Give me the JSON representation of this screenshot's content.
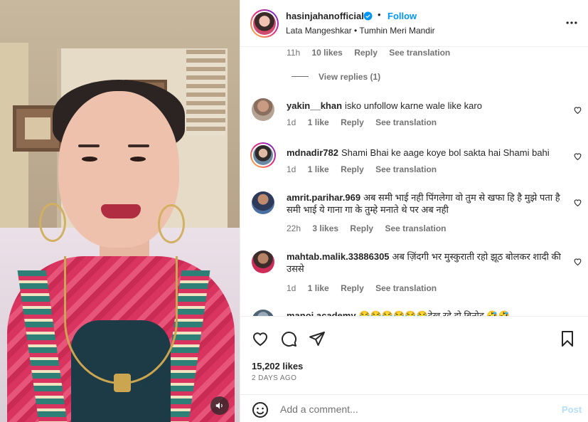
{
  "header": {
    "username": "hasinjahanofficial",
    "separator": "•",
    "follow_label": "Follow",
    "audio": "Lata Mangeshkar • Tumhin Meri Mandir"
  },
  "top_meta": {
    "time": "11h",
    "likes": "10 likes",
    "reply": "Reply",
    "translate": "See translation"
  },
  "view_replies": "View replies (1)",
  "comments": [
    {
      "user": "yakin__khan",
      "text": "isko unfollow karne wale like karo",
      "time": "1d",
      "likes": "1 like",
      "reply": "Reply",
      "translate": "See translation"
    },
    {
      "user": "mdnadir782",
      "text": "Shami Bhai ke aage koye bol sakta hai Shami bahi",
      "time": "1d",
      "likes": "1 like",
      "reply": "Reply",
      "translate": "See translation"
    },
    {
      "user": "amrit.parihar.969",
      "text": "अब समी भाई नही पिंगलेगा वो तुम से खफा हि है मुझे पता है समी भाई ये गाना गा के तुम्हे मनाते थे पर अब नही",
      "time": "22h",
      "likes": "3 likes",
      "reply": "Reply",
      "translate": "See translation"
    },
    {
      "user": "mahtab.malik.33886305",
      "text": "अब ज़िंदगी भर मुस्कुराती रहो झूठ बोलकर शादी की उससे",
      "time": "1d",
      "likes": "1 like",
      "reply": "Reply",
      "translate": "See translation"
    },
    {
      "user": "manoj.academy",
      "text": "😂😂😂😂😂😂देख रहे हो बिनोद 🤣🤣",
      "time": "",
      "likes": "",
      "reply": "",
      "translate": ""
    }
  ],
  "actions": {
    "likes": "15,202 likes",
    "date": "2 DAYS AGO"
  },
  "add_comment": {
    "placeholder": "Add a comment...",
    "post_label": "Post"
  },
  "colors": {
    "accent": "#0095f6",
    "post_disabled": "#b2dffc",
    "muted": "#737373"
  },
  "icons": [
    "verified-icon",
    "more-icon",
    "heart-icon",
    "comment-icon",
    "share-icon",
    "bookmark-icon",
    "emoji-icon",
    "sound-icon"
  ]
}
